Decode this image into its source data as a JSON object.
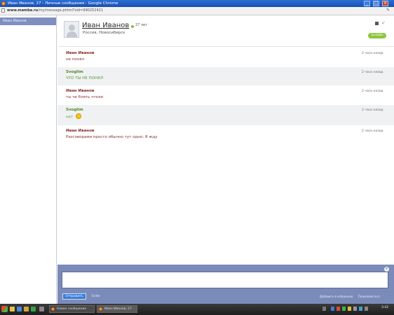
{
  "window": {
    "title": "Иван Иванов, 27 - Личные сообщения - Google Chrome",
    "controls": {
      "minimize": "_",
      "maximize": "□",
      "close": "×"
    }
  },
  "address_bar": {
    "url_domain": "www.mamba.ru",
    "url_path": "/my/message.phtml?oid=990252421"
  },
  "sidebar": {
    "active_contact": "Иван Иванов"
  },
  "profile": {
    "name": "Иван Иванов",
    "age": "27 лет",
    "location": "Россия, Новосибирск",
    "status": "онлайн",
    "online_color": "#7cbf3c"
  },
  "messages": [
    {
      "author": "Иван Иванов",
      "text": "не понял",
      "time": "2 часа назад",
      "style": "red"
    },
    {
      "author": "Svoglim",
      "text": "ЧТО ТЫ НЕ ПОНЯЛ",
      "time": "2 часа назад",
      "style": "green"
    },
    {
      "author": "Иван Иванов",
      "text": "ты че блять чтоли",
      "time": "2 часа назад",
      "style": "red"
    },
    {
      "author": "Svoglim",
      "text": "нет",
      "time": "2 часа назад",
      "style": "green",
      "emoticon": "smiley-icon"
    },
    {
      "author": "Иван Иванов",
      "text": "Разговорами просто обычно тут одно: Я жду",
      "time": "2 часа назад",
      "style": "red"
    }
  ],
  "composer": {
    "send_label": "Отправить",
    "hint": "Enter",
    "option1": "Добавить в избранное",
    "option2": "Пожаловаться",
    "close": "×"
  },
  "taskbar": {
    "task1": "Новое сообщение",
    "task2": "Иван Иванов, 27",
    "clock": "3:42"
  },
  "colors": {
    "sidebar_active": "#7e8fc0",
    "composer_bg": "#7b8bb9",
    "author_red": "#8a2b2b",
    "author_green": "#4a8a2a"
  }
}
